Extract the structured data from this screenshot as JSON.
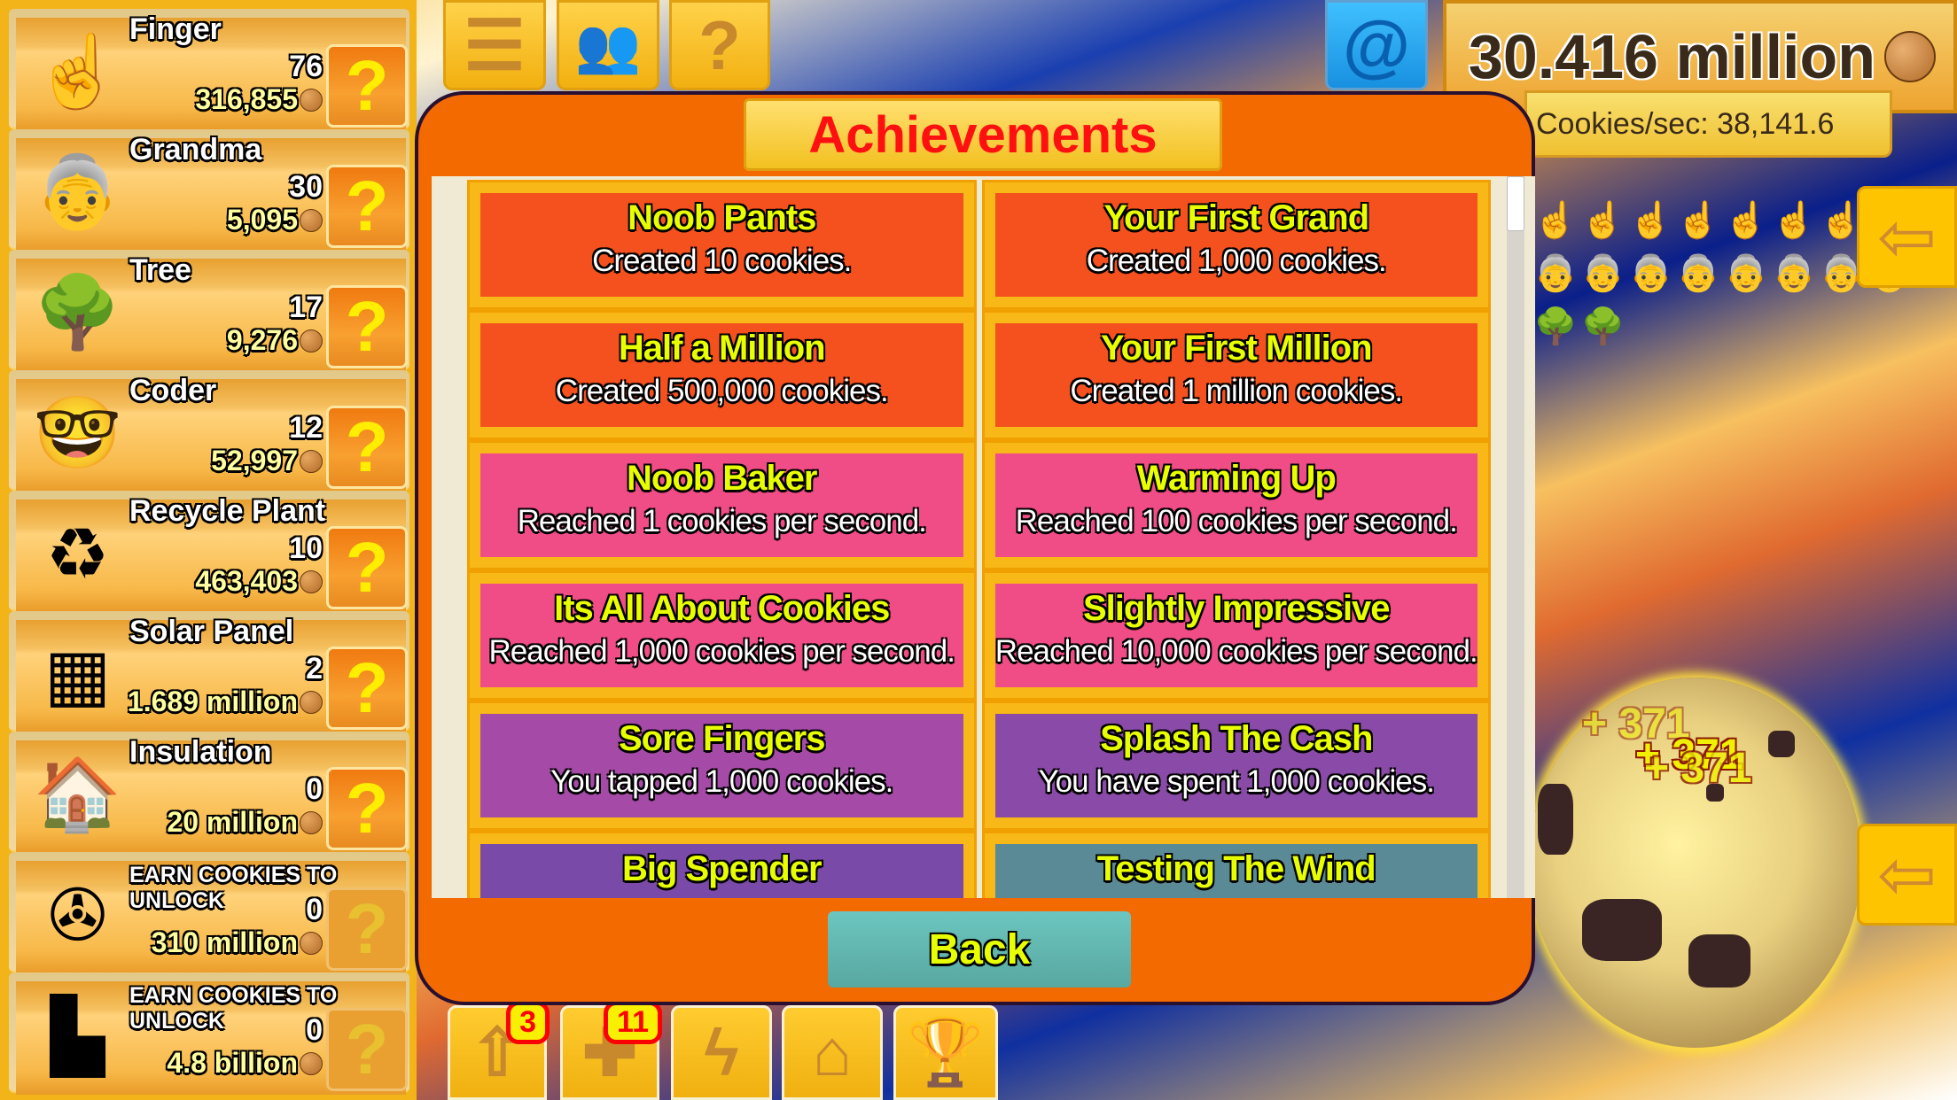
{
  "sidebar": {
    "items": [
      {
        "name": "Finger",
        "count": "76",
        "price": "316,855",
        "icon": "pointing-hand-icon",
        "glyph": "☝",
        "locked": false
      },
      {
        "name": "Grandma",
        "count": "30",
        "price": "5,095",
        "icon": "grandma-icon",
        "glyph": "👵",
        "locked": false
      },
      {
        "name": "Tree",
        "count": "17",
        "price": "9,276",
        "icon": "tree-icon",
        "glyph": "🌳",
        "locked": false
      },
      {
        "name": "Coder",
        "count": "12",
        "price": "52,997",
        "icon": "coder-icon",
        "glyph": "🤓",
        "locked": false
      },
      {
        "name": "Recycle Plant",
        "count": "10",
        "price": "463,403",
        "icon": "recycle-cube-icon",
        "glyph": "♻",
        "locked": false
      },
      {
        "name": "Solar Panel",
        "count": "2",
        "price": "1.689 million",
        "icon": "solar-panel-icon",
        "glyph": "▦",
        "locked": false
      },
      {
        "name": "Insulation",
        "count": "0",
        "price": "20 million",
        "icon": "house-icon",
        "glyph": "🏠",
        "locked": false
      },
      {
        "name": "EARN COOKIES TO UNLOCK",
        "count": "0",
        "price": "310 million",
        "icon": "wind-turbine-silhouette-icon",
        "glyph": "✇",
        "locked": true
      },
      {
        "name": "EARN COOKIES TO UNLOCK",
        "count": "0",
        "price": "4.8 billion",
        "icon": "power-plant-silhouette-icon",
        "glyph": "▙",
        "locked": true
      }
    ],
    "help_glyph": "?"
  },
  "header": {
    "cookies": "30.416 million",
    "cps": "Cookies/sec: 38,141.6"
  },
  "modal": {
    "title": "Achievements",
    "back_label": "Back",
    "achievements": [
      {
        "title": "Noob Pants",
        "desc": "Created 10 cookies.",
        "color": "#f4511e"
      },
      {
        "title": "Your First Grand",
        "desc": "Created 1,000 cookies.",
        "color": "#f4511e"
      },
      {
        "title": "Half a Million",
        "desc": "Created 500,000 cookies.",
        "color": "#f4511e"
      },
      {
        "title": "Your First Million",
        "desc": "Created 1 million cookies.",
        "color": "#f4511e"
      },
      {
        "title": "Noob Baker",
        "desc": "Reached 1 cookies per second.",
        "color": "#f04d86"
      },
      {
        "title": "Warming Up",
        "desc": "Reached 100 cookies per second.",
        "color": "#f04d86"
      },
      {
        "title": "Its All About Cookies",
        "desc": "Reached 1,000 cookies per second.",
        "color": "#f04d86"
      },
      {
        "title": "Slightly Impressive",
        "desc": "Reached 10,000 cookies per second.",
        "color": "#f04d86"
      },
      {
        "title": "Sore Fingers",
        "desc": "You tapped 1,000 cookies.",
        "color": "#a64aa8"
      },
      {
        "title": "Splash The Cash",
        "desc": "You have spent 1,000 cookies.",
        "color": "#8a4aa8"
      },
      {
        "title": "Big Spender",
        "desc": "",
        "color": "#7a4aa8"
      },
      {
        "title": "Testing The Wind",
        "desc": "",
        "color": "#5a8a96"
      }
    ]
  },
  "bottom_bar": {
    "upgrades_badge": "3",
    "boosts_badge": "11"
  },
  "floating_gains": [
    "+ 371",
    "+ 371",
    "+ 371"
  ],
  "colors": {
    "accent": "#f26a00",
    "title_red": "#ff1010",
    "achievement_title": "#e8ff00"
  }
}
